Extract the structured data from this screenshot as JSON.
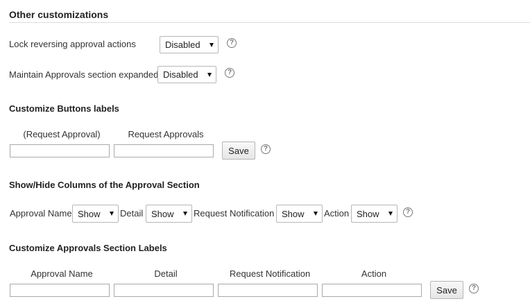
{
  "section_title": "Other customizations",
  "settings": {
    "lock_reversing": {
      "label": "Lock reversing approval actions",
      "value": "Disabled"
    },
    "maintain_expanded": {
      "label": "Maintain Approvals section expanded",
      "value": "Disabled"
    }
  },
  "buttons_labels": {
    "title": "Customize Buttons labels",
    "headers": [
      "(Request Approval)",
      "Request Approvals"
    ],
    "save_label": "Save"
  },
  "show_hide": {
    "title": "Show/Hide Columns of the Approval Section",
    "columns": [
      {
        "label": "Approval Name",
        "value": "Show"
      },
      {
        "label": "Detail",
        "value": "Show"
      },
      {
        "label": "Request Notification",
        "value": "Show"
      },
      {
        "label": "Action",
        "value": "Show"
      }
    ]
  },
  "section_labels": {
    "title": "Customize Approvals Section Labels",
    "headers": [
      "Approval Name",
      "Detail",
      "Request Notification",
      "Action"
    ],
    "save_label": "Save"
  },
  "icons": {
    "help": "help-icon",
    "dropdown": "chevron-down-icon"
  },
  "colors": {
    "divider": "#dcdcdc",
    "text": "#333333",
    "heading": "#222222"
  }
}
